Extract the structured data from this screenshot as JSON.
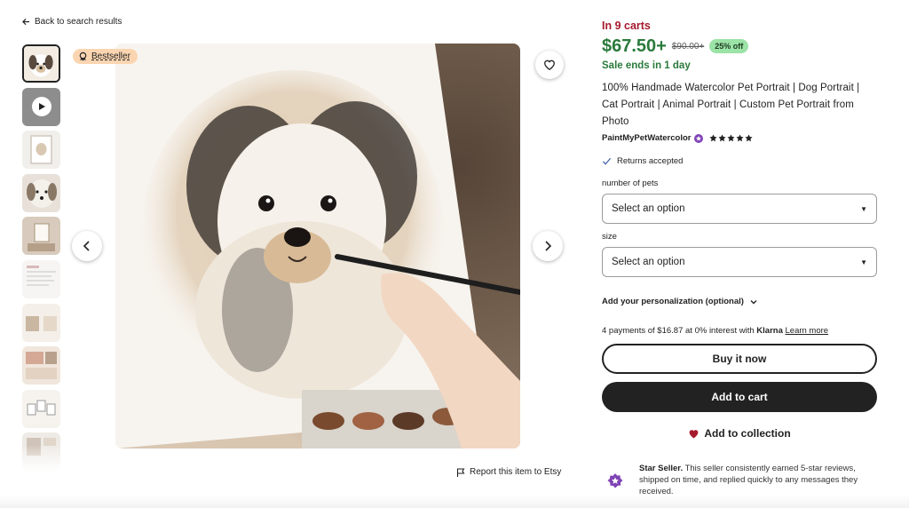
{
  "nav": {
    "back_label": "Back to search results"
  },
  "gallery": {
    "badge_label": "Bestseller",
    "report_label": "Report this item to Etsy",
    "thumbnail_count": 10
  },
  "listing": {
    "in_carts": "In 9 carts",
    "price": "$67.50+",
    "original_price": "$90.00+",
    "discount": "25% off",
    "sale_ends": "Sale ends in 1 day",
    "title": "100% Handmade Watercolor Pet Portrait | Dog Portrait | Cat Portrait | Animal Portrait | Custom Pet Portrait from Photo",
    "shop_name": "PaintMyPetWatercolor",
    "rating_stars": 5,
    "returns": "Returns accepted"
  },
  "options": {
    "pets_label": "number of pets",
    "pets_value": "Select an option",
    "size_label": "size",
    "size_value": "Select an option",
    "personalization_label": "Add your personalization (optional)"
  },
  "payment": {
    "klarna_prefix": "4 payments of $16.87 at 0% interest with",
    "klarna_brand": "Klarna",
    "learn_more": "Learn more"
  },
  "actions": {
    "buy_now": "Buy it now",
    "add_to_cart": "Add to cart",
    "add_to_collection": "Add to collection"
  },
  "star_seller": {
    "title": "Star Seller.",
    "text": "This seller consistently earned 5-star reviews, shipped on time, and replied quickly to any messages they received."
  },
  "colors": {
    "sale_green": "#2a7a3b",
    "cart_red": "#a61a2e",
    "discount_bg": "#9be3a6",
    "badge_bg": "#fbd5b1",
    "dark_button": "#222222",
    "star_seller_purple": "#7f44b5"
  }
}
